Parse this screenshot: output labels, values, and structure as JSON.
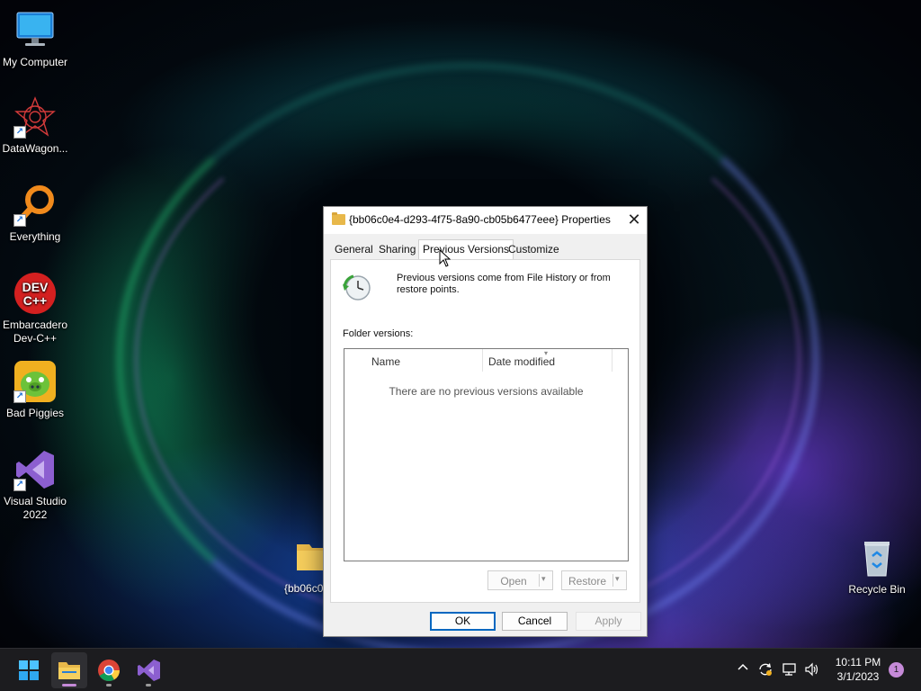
{
  "desktop": {
    "icons": [
      {
        "label": "My Computer"
      },
      {
        "label": "DataWagon..."
      },
      {
        "label": "Everything"
      },
      {
        "label": "Embarcadero Dev-C++"
      },
      {
        "label": "Bad Piggies"
      },
      {
        "label": "Visual Studio 2022"
      },
      {
        "label": "Recycle Bin"
      }
    ],
    "folder_label": "{bb06c0",
    "dev_icon_text_top": "DEV",
    "dev_icon_text_bottom": "C++",
    "shortcut_glyph": "↗"
  },
  "dialog": {
    "title": "{bb06c0e4-d293-4f75-8a90-cb05b6477eee} Properties",
    "close_glyph": "✕",
    "tabs": [
      "General",
      "Sharing",
      "Previous Versions",
      "Customize"
    ],
    "active_tab": "Previous Versions",
    "info_text": "Previous versions come from File History or from restore points.",
    "folder_versions_label": "Folder versions:",
    "columns": [
      "Name",
      "Date modified"
    ],
    "empty_message": "There are no previous versions available",
    "open_button": "Open",
    "restore_button": "Restore",
    "dropdown_glyph": "▾",
    "ok_button": "OK",
    "cancel_button": "Cancel",
    "apply_button": "Apply"
  },
  "taskbar": {
    "clock_time": "10:11 PM",
    "clock_date": "3/1/2023",
    "notification_count": "1",
    "tray_glyphs": {
      "chevron": "^",
      "volume": "🔊"
    }
  },
  "colors": {
    "accent": "#0067c0",
    "dialog_bg": "#f0f0f0",
    "taskbar_bg": "#1c1c1f"
  }
}
